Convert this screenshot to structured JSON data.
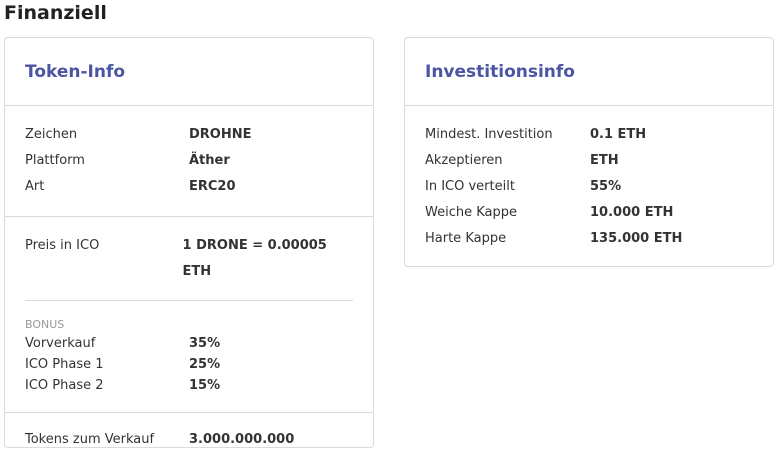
{
  "page_title": "Finanziell",
  "token_info": {
    "title": "Token-Info",
    "basic": [
      {
        "label": "Zeichen",
        "value": "DROHNE"
      },
      {
        "label": "Plattform",
        "value": "Äther"
      },
      {
        "label": "Art",
        "value": "ERC20"
      }
    ],
    "price": {
      "label": "Preis in ICO",
      "value": "1 DRONE = 0.00005 ETH"
    },
    "bonus_heading": "BONUS",
    "bonus": [
      {
        "label": "Vorverkauf",
        "value": "35%"
      },
      {
        "label": "ICO Phase 1",
        "value": "25%"
      },
      {
        "label": "ICO Phase 2",
        "value": "15%"
      }
    ],
    "tokens_for_sale": {
      "label": "Tokens zum Verkauf",
      "value": "3.000.000.000"
    }
  },
  "investment_info": {
    "title": "Investitionsinfo",
    "rows": [
      {
        "label": "Mindest. Investition",
        "value": "0.1 ETH"
      },
      {
        "label": "Akzeptieren",
        "value": "ETH"
      },
      {
        "label": "In ICO verteilt",
        "value": "55%"
      },
      {
        "label": "Weiche Kappe",
        "value": "10.000 ETH"
      },
      {
        "label": "Harte Kappe",
        "value": "135.000 ETH"
      }
    ]
  },
  "colors": {
    "accent": "#4b55a4",
    "border": "#d9dbe0",
    "muted": "#9a9a9a"
  }
}
